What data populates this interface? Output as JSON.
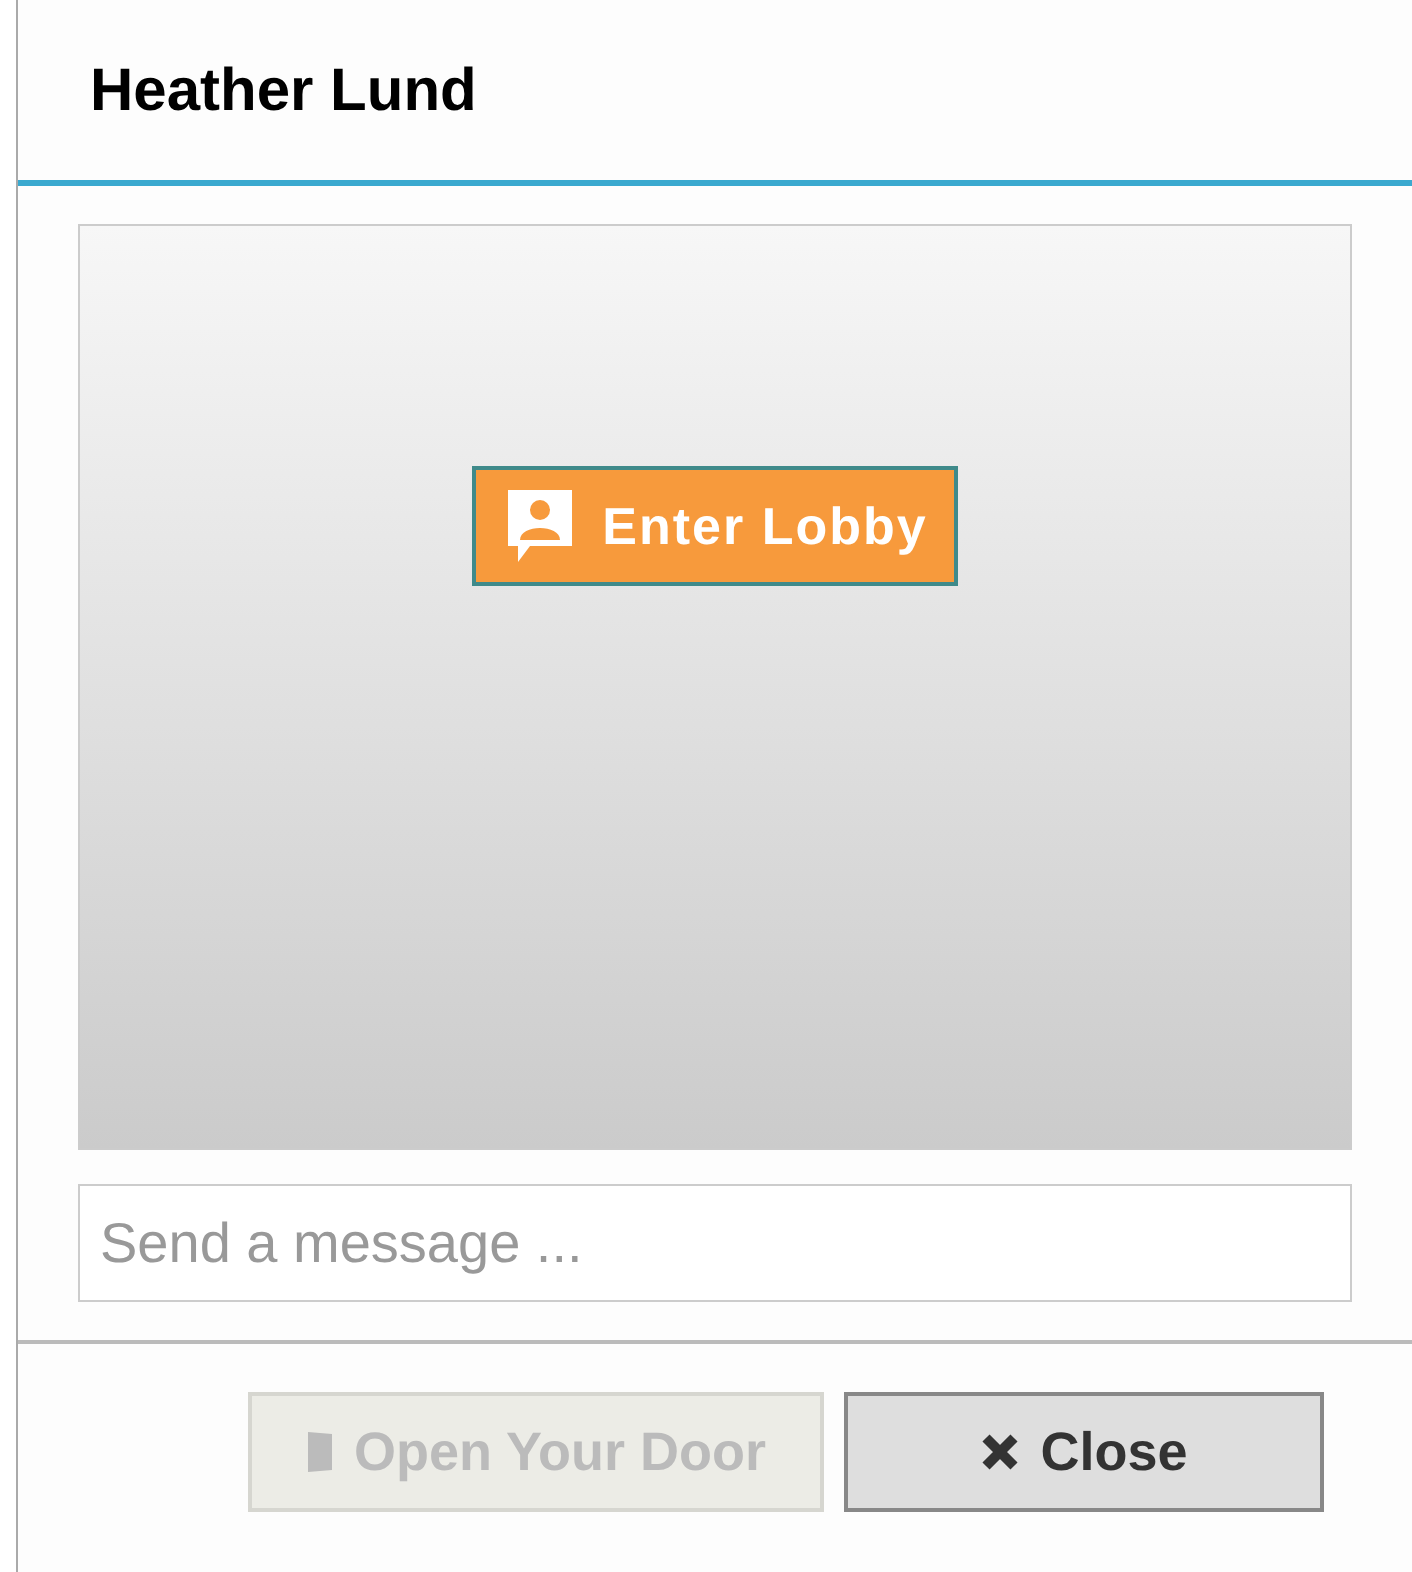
{
  "dialog": {
    "title": "Heather Lund"
  },
  "video": {
    "lobby_button": {
      "label": "Enter Lobby"
    }
  },
  "message_field": {
    "placeholder": "Send a message ..."
  },
  "buttons": [
    {
      "kind": "door",
      "label": "Open Your Door",
      "disabled": true
    },
    {
      "kind": "close",
      "label": "Close",
      "disabled": false
    }
  ]
}
